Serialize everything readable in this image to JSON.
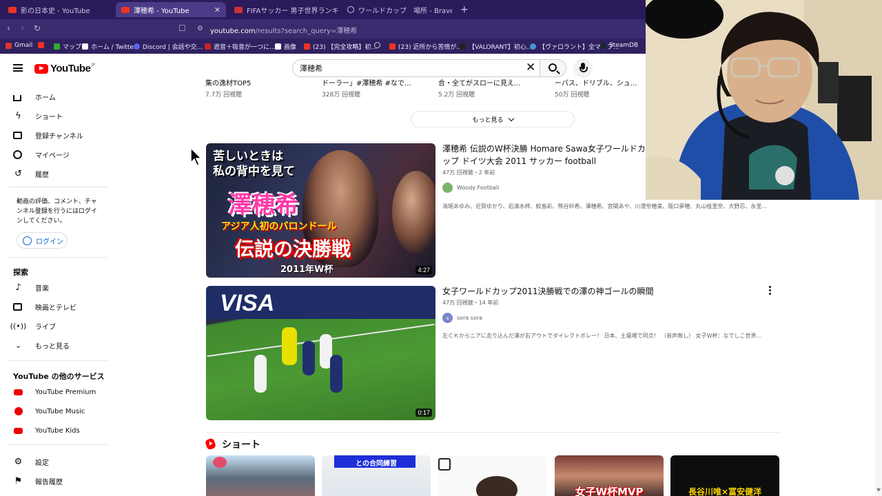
{
  "browser": {
    "tabs": [
      {
        "title": "影の日本史 - YouTube",
        "active": false
      },
      {
        "title": "澤穂希 - YouTube",
        "active": true
      },
      {
        "title": "FIFAサッカー 男子世界ランキング | J SPORTS",
        "active": false
      },
      {
        "title": "ワールドカップ　場所 - Brave Search",
        "active": false
      }
    ],
    "url_host": "youtube.com",
    "url_path": "/results?search_query=澤穂希",
    "bookmarks": [
      "Gmail",
      "マップ",
      "ホーム / Twitter",
      "Discord | 会話や交...",
      "遮音＋吸音が一つに...",
      "画像",
      "(23) 【完全攻略】初...",
      "",
      "(23) 近所から苦情が...",
      "【VALORANT】初心...",
      "【ヴァロラント】全マップ...",
      "SteamDB"
    ]
  },
  "header": {
    "logo": "YouTube",
    "logo_region": "JP",
    "search_value": "澤穂希"
  },
  "sidebar": {
    "main_items": [
      {
        "label": "ホーム",
        "icon": "home-icon"
      },
      {
        "label": "ショート",
        "icon": "shorts-icon"
      },
      {
        "label": "登録チャンネル",
        "icon": "subscriptions-icon"
      },
      {
        "label": "マイページ",
        "icon": "account-icon"
      },
      {
        "label": "履歴",
        "icon": "history-icon"
      }
    ],
    "signin_prompt": "動画の評価、コメント、チャンネル登録を行うにはログインしてください。",
    "login_label": "ログイン",
    "explore_heading": "探索",
    "explore_items": [
      {
        "label": "音楽",
        "icon": "music-note-icon"
      },
      {
        "label": "映画とテレビ",
        "icon": "film-icon"
      },
      {
        "label": "ライブ",
        "icon": "live-icon"
      },
      {
        "label": "もっと見る",
        "icon": "chevron-down-icon"
      }
    ],
    "more_services_heading": "YouTube の他のサービス",
    "services": [
      {
        "label": "YouTube Premium",
        "icon": "youtube-premium-icon"
      },
      {
        "label": "YouTube Music",
        "icon": "youtube-music-icon"
      },
      {
        "label": "YouTube Kids",
        "icon": "youtube-kids-icon"
      }
    ],
    "bottom_items": [
      {
        "label": "設定",
        "icon": "gear-icon"
      },
      {
        "label": "報告履歴",
        "icon": "flag-icon"
      }
    ]
  },
  "results": {
    "top_row": [
      {
        "title_fragment": "集の逸材TOP5",
        "views": "7.7万 回視聴"
      },
      {
        "title_fragment": "ドーラー」#澤穂希 #なで...",
        "views": "328万 回視聴"
      },
      {
        "title_fragment": "合・全てがスローに見え...",
        "views": "5.2万 回視聴"
      },
      {
        "title_fragment": "ーパス、ドリブル、シュ...",
        "views": "50万 回視聴"
      }
    ],
    "more_label": "もっと見る",
    "videos": [
      {
        "title": "澤穂希 伝説のW杯決勝 Homare Sawa女子ワールドカップ ドイツ大会 2011 サッカー football",
        "meta": "47万 回視聴・2 年前",
        "channel": "Woody Football",
        "description": "海堀あゆみ、近賀ゆかり、岩清水梓、鮫島彩、熊谷紗希、澤穂希、宮間あや、川澄奈穂美、阪口夢穂、丸山桂里奈、大野忍、永里...",
        "duration": "4:27",
        "thumb_text": [
          "苦しいときは",
          "私の背中を見て",
          "澤穂希",
          "アジア人初のバロンドール",
          "伝説の決勝戦",
          "2011年W杯"
        ]
      },
      {
        "title": "女子ワールドカップ2011決勝戦での澤の神ゴールの瞬間",
        "meta": "47万 回視聴・14 年前",
        "channel": "sora sora",
        "channel_initial": "s",
        "description": "左ＣＫからニアに走り込んだ澤が右アウトでダイレクトボレー！ 日本、土壇場で同点！ （音声無し） 女子W杯：なでしこ世界...",
        "duration": "0:17",
        "thumb_text": [
          "VISA"
        ]
      }
    ],
    "shorts_heading": "ショート",
    "shorts_captions": [
      "",
      "との合同練習",
      "",
      "女子W杯MVP",
      "長谷川唯×冨安健洋"
    ]
  },
  "colors": {
    "accent": "#ff0000",
    "link": "#065fd4",
    "browser_chrome": "#2b1a5c"
  }
}
